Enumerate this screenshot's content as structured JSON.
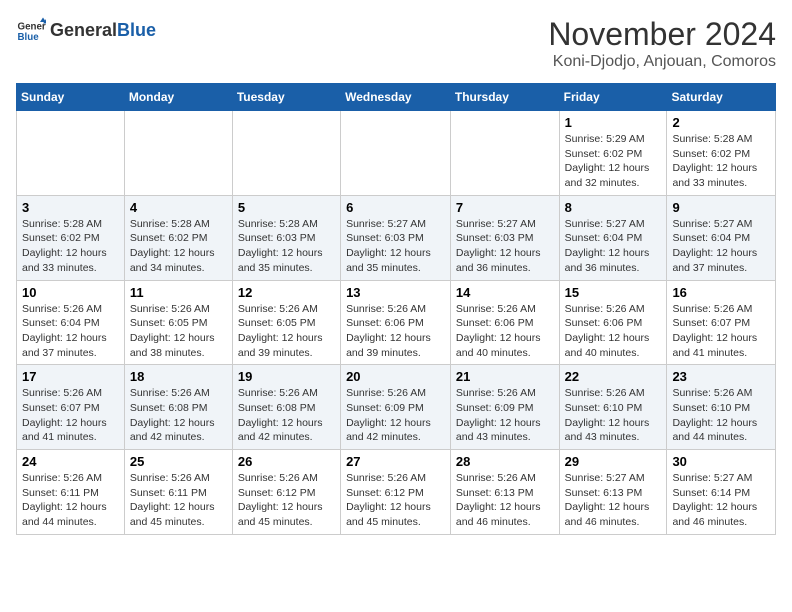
{
  "logo": {
    "general": "General",
    "blue": "Blue"
  },
  "title": {
    "month": "November 2024",
    "location": "Koni-Djodjo, Anjouan, Comoros"
  },
  "weekdays": [
    "Sunday",
    "Monday",
    "Tuesday",
    "Wednesday",
    "Thursday",
    "Friday",
    "Saturday"
  ],
  "weeks": [
    [
      {
        "day": "",
        "info": ""
      },
      {
        "day": "",
        "info": ""
      },
      {
        "day": "",
        "info": ""
      },
      {
        "day": "",
        "info": ""
      },
      {
        "day": "",
        "info": ""
      },
      {
        "day": "1",
        "info": "Sunrise: 5:29 AM\nSunset: 6:02 PM\nDaylight: 12 hours and 32 minutes."
      },
      {
        "day": "2",
        "info": "Sunrise: 5:28 AM\nSunset: 6:02 PM\nDaylight: 12 hours and 33 minutes."
      }
    ],
    [
      {
        "day": "3",
        "info": "Sunrise: 5:28 AM\nSunset: 6:02 PM\nDaylight: 12 hours and 33 minutes."
      },
      {
        "day": "4",
        "info": "Sunrise: 5:28 AM\nSunset: 6:02 PM\nDaylight: 12 hours and 34 minutes."
      },
      {
        "day": "5",
        "info": "Sunrise: 5:28 AM\nSunset: 6:03 PM\nDaylight: 12 hours and 35 minutes."
      },
      {
        "day": "6",
        "info": "Sunrise: 5:27 AM\nSunset: 6:03 PM\nDaylight: 12 hours and 35 minutes."
      },
      {
        "day": "7",
        "info": "Sunrise: 5:27 AM\nSunset: 6:03 PM\nDaylight: 12 hours and 36 minutes."
      },
      {
        "day": "8",
        "info": "Sunrise: 5:27 AM\nSunset: 6:04 PM\nDaylight: 12 hours and 36 minutes."
      },
      {
        "day": "9",
        "info": "Sunrise: 5:27 AM\nSunset: 6:04 PM\nDaylight: 12 hours and 37 minutes."
      }
    ],
    [
      {
        "day": "10",
        "info": "Sunrise: 5:26 AM\nSunset: 6:04 PM\nDaylight: 12 hours and 37 minutes."
      },
      {
        "day": "11",
        "info": "Sunrise: 5:26 AM\nSunset: 6:05 PM\nDaylight: 12 hours and 38 minutes."
      },
      {
        "day": "12",
        "info": "Sunrise: 5:26 AM\nSunset: 6:05 PM\nDaylight: 12 hours and 39 minutes."
      },
      {
        "day": "13",
        "info": "Sunrise: 5:26 AM\nSunset: 6:06 PM\nDaylight: 12 hours and 39 minutes."
      },
      {
        "day": "14",
        "info": "Sunrise: 5:26 AM\nSunset: 6:06 PM\nDaylight: 12 hours and 40 minutes."
      },
      {
        "day": "15",
        "info": "Sunrise: 5:26 AM\nSunset: 6:06 PM\nDaylight: 12 hours and 40 minutes."
      },
      {
        "day": "16",
        "info": "Sunrise: 5:26 AM\nSunset: 6:07 PM\nDaylight: 12 hours and 41 minutes."
      }
    ],
    [
      {
        "day": "17",
        "info": "Sunrise: 5:26 AM\nSunset: 6:07 PM\nDaylight: 12 hours and 41 minutes."
      },
      {
        "day": "18",
        "info": "Sunrise: 5:26 AM\nSunset: 6:08 PM\nDaylight: 12 hours and 42 minutes."
      },
      {
        "day": "19",
        "info": "Sunrise: 5:26 AM\nSunset: 6:08 PM\nDaylight: 12 hours and 42 minutes."
      },
      {
        "day": "20",
        "info": "Sunrise: 5:26 AM\nSunset: 6:09 PM\nDaylight: 12 hours and 42 minutes."
      },
      {
        "day": "21",
        "info": "Sunrise: 5:26 AM\nSunset: 6:09 PM\nDaylight: 12 hours and 43 minutes."
      },
      {
        "day": "22",
        "info": "Sunrise: 5:26 AM\nSunset: 6:10 PM\nDaylight: 12 hours and 43 minutes."
      },
      {
        "day": "23",
        "info": "Sunrise: 5:26 AM\nSunset: 6:10 PM\nDaylight: 12 hours and 44 minutes."
      }
    ],
    [
      {
        "day": "24",
        "info": "Sunrise: 5:26 AM\nSunset: 6:11 PM\nDaylight: 12 hours and 44 minutes."
      },
      {
        "day": "25",
        "info": "Sunrise: 5:26 AM\nSunset: 6:11 PM\nDaylight: 12 hours and 45 minutes."
      },
      {
        "day": "26",
        "info": "Sunrise: 5:26 AM\nSunset: 6:12 PM\nDaylight: 12 hours and 45 minutes."
      },
      {
        "day": "27",
        "info": "Sunrise: 5:26 AM\nSunset: 6:12 PM\nDaylight: 12 hours and 45 minutes."
      },
      {
        "day": "28",
        "info": "Sunrise: 5:26 AM\nSunset: 6:13 PM\nDaylight: 12 hours and 46 minutes."
      },
      {
        "day": "29",
        "info": "Sunrise: 5:27 AM\nSunset: 6:13 PM\nDaylight: 12 hours and 46 minutes."
      },
      {
        "day": "30",
        "info": "Sunrise: 5:27 AM\nSunset: 6:14 PM\nDaylight: 12 hours and 46 minutes."
      }
    ]
  ]
}
